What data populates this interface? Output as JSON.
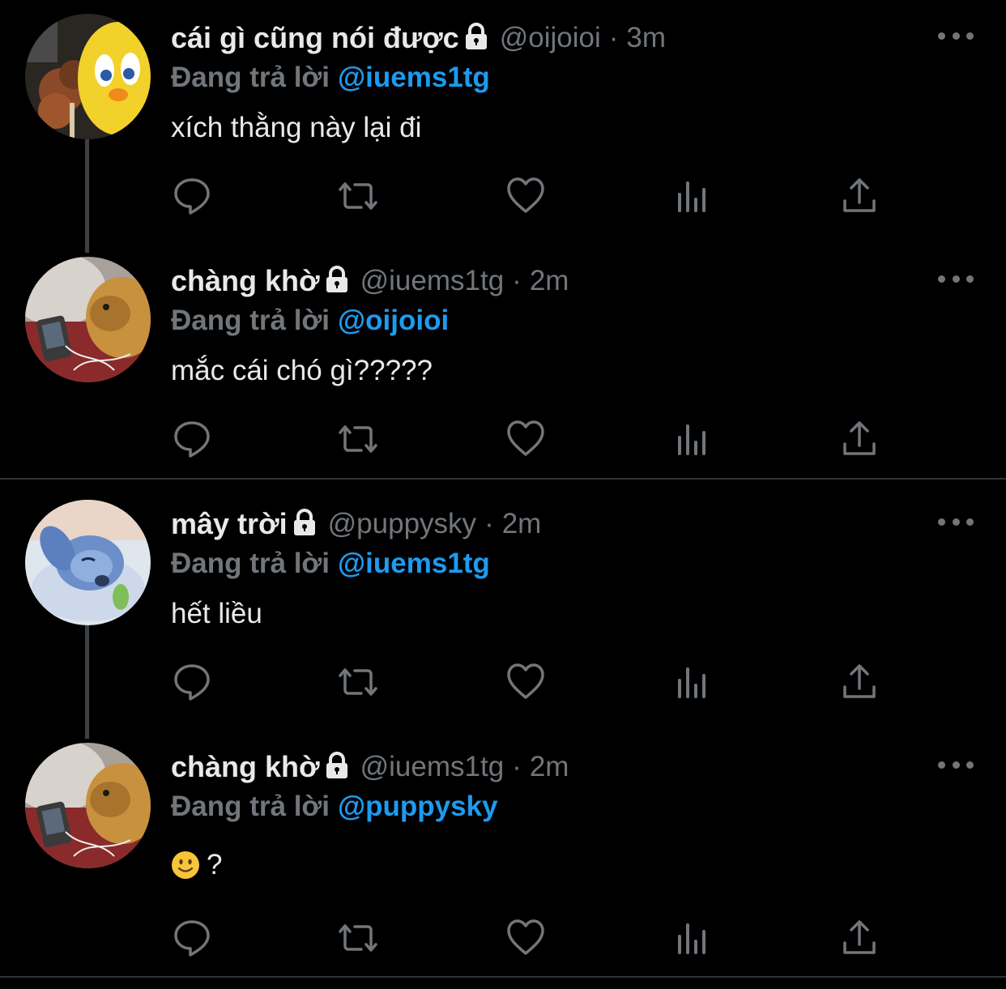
{
  "tweets": [
    {
      "name": "cái gì cũng nói được",
      "handle": "@oijoioi",
      "dot": "·",
      "time": "3m",
      "reply_label": "Đang trả lời",
      "reply_to": "@iuems1tg",
      "text": "xích thằng này lại đi"
    },
    {
      "name": "chàng khờ",
      "handle": "@iuems1tg",
      "dot": "·",
      "time": "2m",
      "reply_label": "Đang trả lời",
      "reply_to": "@oijoioi",
      "text": "mắc cái chó gì?????"
    },
    {
      "name": "mây trời",
      "handle": "@puppysky",
      "dot": "·",
      "time": "2m",
      "reply_label": "Đang trả lời",
      "reply_to": "@iuems1tg",
      "text": "hết liều"
    },
    {
      "name": "chàng khờ",
      "handle": "@iuems1tg",
      "dot": "·",
      "time": "2m",
      "reply_label": "Đang trả lời",
      "reply_to": "@puppysky",
      "text": "?",
      "emoji": "slightly-smiling-face"
    }
  ],
  "icons": {
    "lock": "lock-icon",
    "more": "more-icon",
    "reply": "reply-icon",
    "retweet": "retweet-icon",
    "like": "heart-icon",
    "analytics": "analytics-icon",
    "share": "share-icon"
  },
  "colors": {
    "background": "#000000",
    "text": "#e7e9ea",
    "muted": "#71767b",
    "link": "#1d9bf0",
    "divider": "#2f3336"
  }
}
